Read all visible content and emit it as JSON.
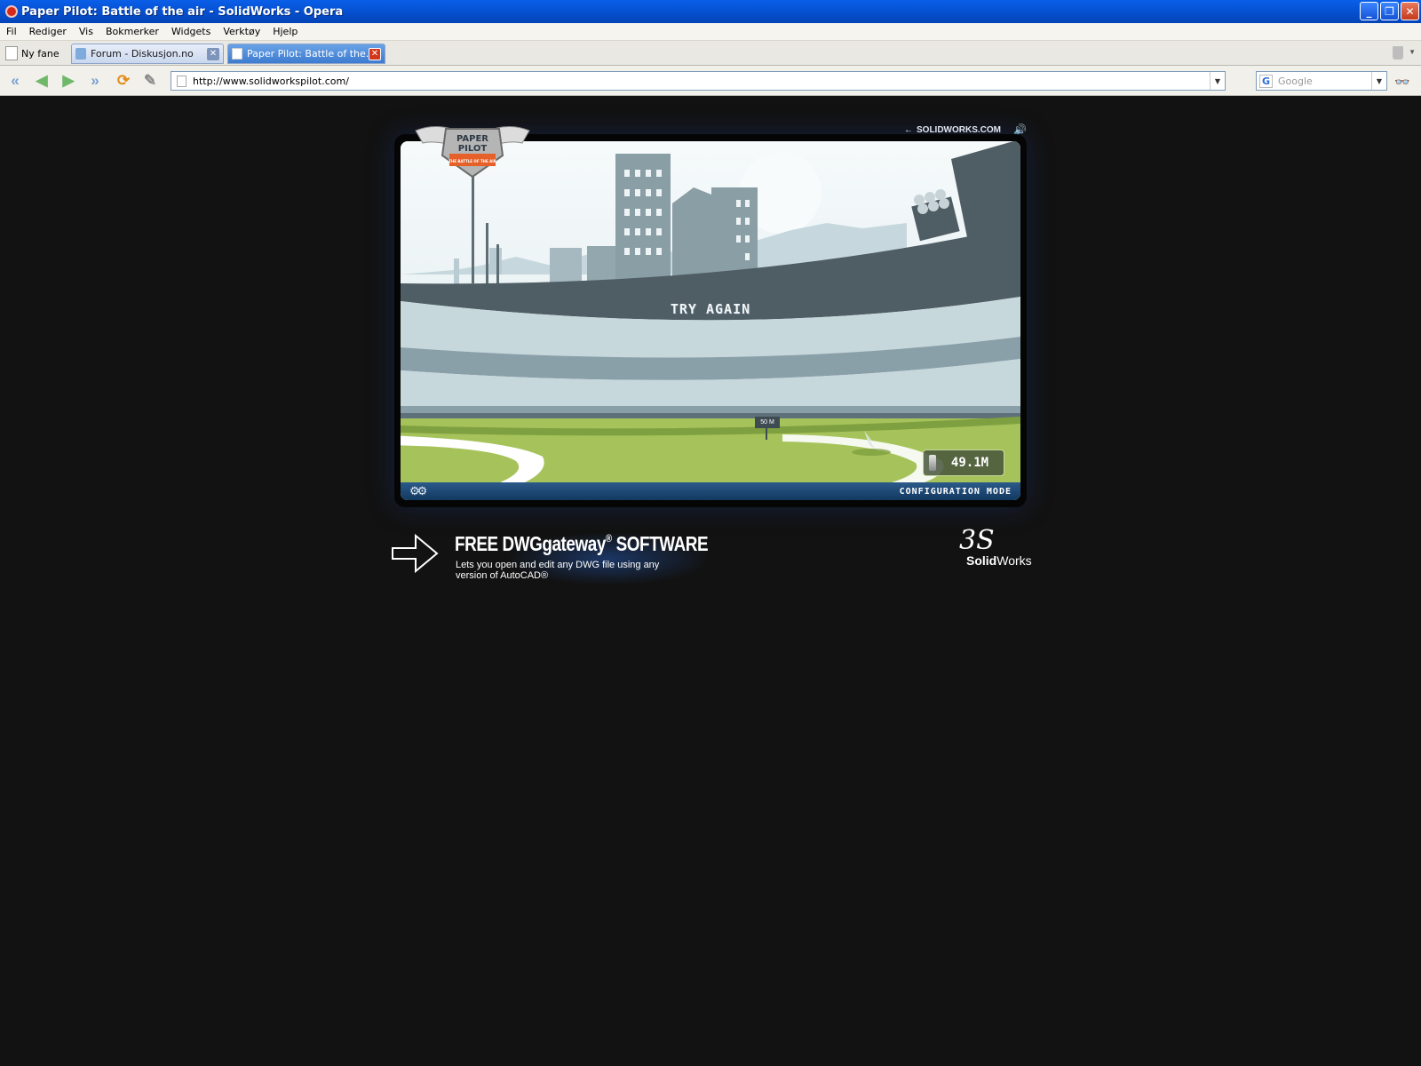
{
  "window": {
    "title": "Paper Pilot: Battle of the air - SolidWorks - Opera",
    "minimize": "_",
    "restore": "❐",
    "close": "✕"
  },
  "menu": [
    "Fil",
    "Rediger",
    "Vis",
    "Bokmerker",
    "Widgets",
    "Verktøy",
    "Hjelp"
  ],
  "tabs": {
    "new_tab_label": "Ny fane",
    "items": [
      {
        "label": "Forum - Diskusjon.no",
        "active": false
      },
      {
        "label": "Paper Pilot: Battle of the...",
        "active": true
      }
    ]
  },
  "toolbar": {
    "url": "http://www.solidworkspilot.com/",
    "search_placeholder": "Google"
  },
  "page": {
    "top_link": "SOLIDWORKS.COM",
    "game": {
      "logo_line1": "PAPER",
      "logo_line2": "PILOT",
      "logo_tagline": "THE BATTLE OF THE AIR",
      "message": "TRY AGAIN",
      "marker": "50 M",
      "distance": "49.1M",
      "config_label": "CONFIGURATION MODE"
    },
    "promo": {
      "headline": "FREE DWGgateway",
      "reg": "®",
      "headline_suffix": " SOFTWARE",
      "sub": "Lets you open and edit any DWG file using any version of AutoCAD®"
    },
    "brand": {
      "ds": "3S",
      "solid": "Solid",
      "works": "Works"
    }
  }
}
